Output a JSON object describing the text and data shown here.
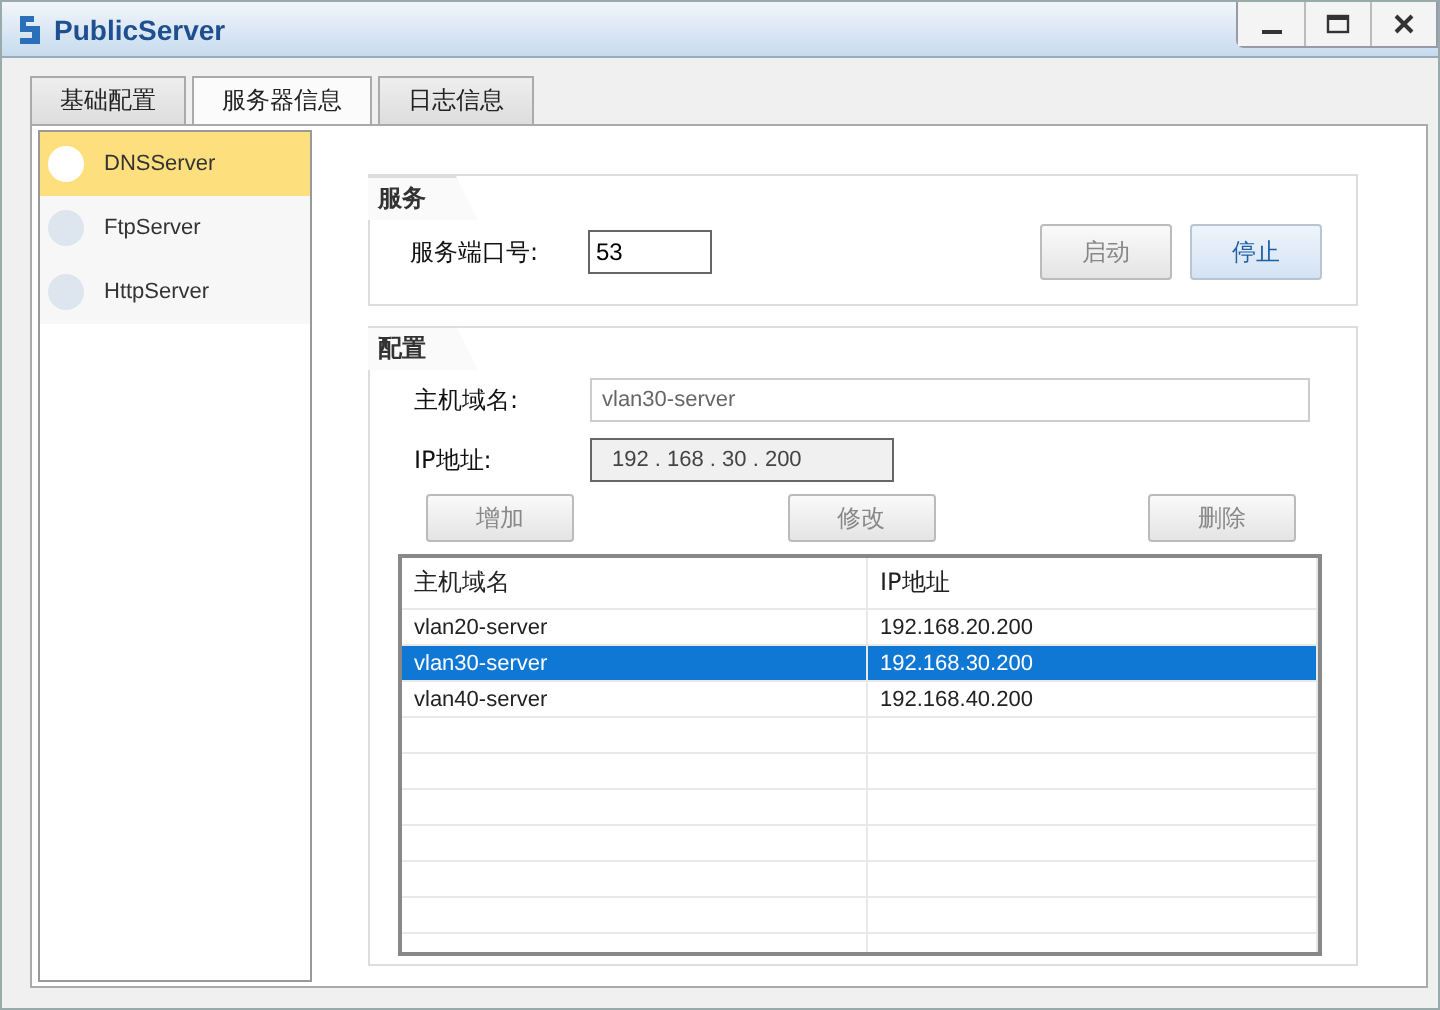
{
  "window": {
    "title": "PublicServer"
  },
  "tabs": [
    {
      "label": "基础配置",
      "selected": false
    },
    {
      "label": "服务器信息",
      "selected": true
    },
    {
      "label": "日志信息",
      "selected": false
    }
  ],
  "sidebar": {
    "items": [
      {
        "label": "DNSServer",
        "selected": true
      },
      {
        "label": "FtpServer",
        "selected": false
      },
      {
        "label": "HttpServer",
        "selected": false
      }
    ]
  },
  "service": {
    "title": "服务",
    "port_label": "服务端口号:",
    "port_value": "53",
    "buttons": [
      {
        "label": "启动",
        "disabled": true
      },
      {
        "label": "停止",
        "disabled": false
      }
    ]
  },
  "config": {
    "title": "配置",
    "host_label": "主机域名:",
    "host_value": "vlan30-server",
    "ip_label": "IP地址:",
    "ip_value": "192 . 168 . 30 . 200",
    "buttons": [
      {
        "label": "增加",
        "disabled": true
      },
      {
        "label": "修改",
        "disabled": true
      },
      {
        "label": "删除",
        "disabled": true
      }
    ],
    "table": {
      "columns": [
        "主机域名",
        "IP地址"
      ],
      "rows": [
        {
          "cells": [
            "vlan20-server",
            "192.168.20.200"
          ],
          "selected": false
        },
        {
          "cells": [
            "vlan30-server",
            "192.168.30.200"
          ],
          "selected": true
        },
        {
          "cells": [
            "vlan40-server",
            "192.168.40.200"
          ],
          "selected": false
        }
      ]
    }
  }
}
